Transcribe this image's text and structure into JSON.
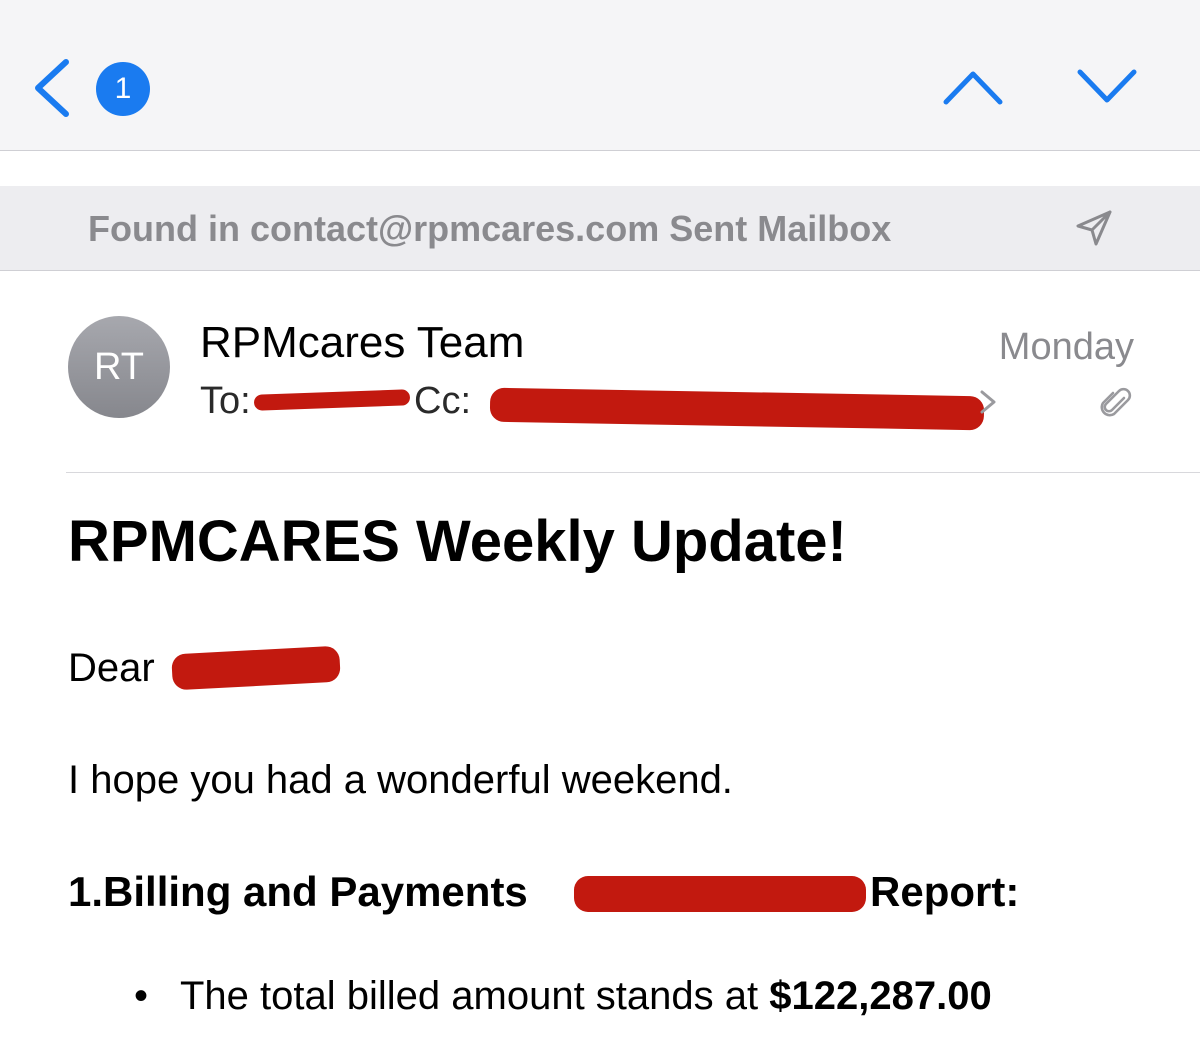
{
  "nav": {
    "badge_count": "1",
    "back_icon": "chevron-left-icon",
    "prev_icon": "chevron-up-icon",
    "next_icon": "chevron-down-icon",
    "accent_color": "#1a7bf0"
  },
  "banner": {
    "text": "Found in contact@rpmcares.com Sent Mailbox",
    "icon": "paper-plane-icon"
  },
  "header": {
    "avatar_initials": "RT",
    "sender": "RPMcares Team",
    "date": "Monday",
    "to_label": "To:",
    "cc_label": "Cc:",
    "attachment_icon": "paperclip-icon"
  },
  "message": {
    "subject": "RPMCARES Weekly Update!",
    "greeting": "Dear",
    "paragraph": "I hope you had a wonderful weekend.",
    "section_title_start": "1.Billing and Payments",
    "section_title_end": "Report:",
    "bullet_text": "The total billed amount stands at ",
    "bullet_amount": "$122,287.00"
  },
  "redaction_color": "#c2190f"
}
